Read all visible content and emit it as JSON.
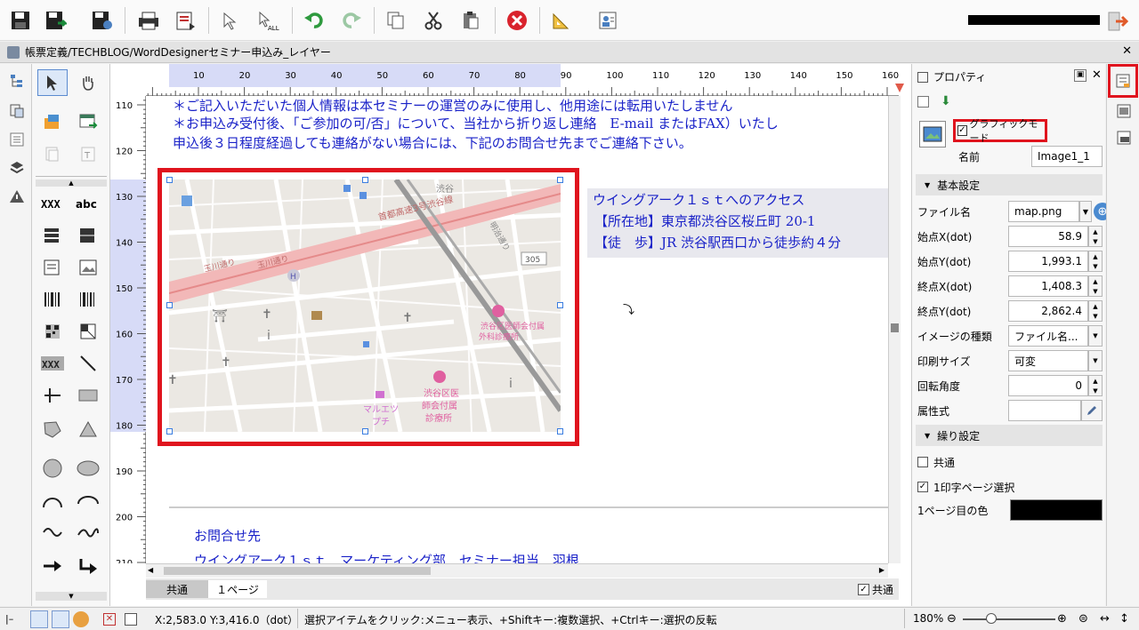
{
  "toolbar": {
    "items": [
      "save-icon",
      "save-as-icon",
      "save-db-icon",
      "print-icon",
      "print-preview-icon",
      "select-tool-icon",
      "select-all-icon",
      "undo-icon",
      "redo-icon",
      "copy-icon",
      "cut-icon",
      "paste-icon",
      "delete-icon",
      "ruler-icon",
      "user-icon"
    ]
  },
  "doc_tab": {
    "title": "帳票定義/TECHBLOG/WordDesignerセミナー申込み_レイヤー"
  },
  "ruler": {
    "h_ticks": [
      "10",
      "20",
      "30",
      "40",
      "50",
      "60",
      "70",
      "80",
      "90",
      "100",
      "110",
      "120",
      "130",
      "140",
      "150",
      "160"
    ],
    "v_ticks": [
      "110",
      "120",
      "130",
      "140",
      "150",
      "160",
      "170",
      "180",
      "190",
      "200",
      "210"
    ]
  },
  "page": {
    "line1": "＊ご記入いただいた個人情報は本セミナーの運営のみに使用し、他用途には転用いたしません",
    "line2": "＊お申込み受付後、「ご参加の可/否」について、当社から折り返し連絡　E-mail またはFAX）いたし",
    "line3": "申込後３日程度経過しても連絡がない場合には、下記のお問合せ先までご連絡下さい。",
    "access_title": "ウイングアーク１ｓｔへのアクセス",
    "access_addr": "【所在地】東京都渋谷区桜丘町 20-1",
    "access_walk": "【徒　歩】JR 渋谷駅西口から徒歩約４分",
    "contact_label": "お問合せ先",
    "contact_detail": "ウイングアーク１ｓｔ　マーケティング部　セミナー担当　羽根"
  },
  "map": {
    "labels": [
      "渋谷",
      "首都高速3号渋谷線",
      "玉川通り",
      "玉川通り",
      "305",
      "明治通り",
      "渋谷区医師会付属",
      "外科診療所",
      "渋谷区医",
      "師会付属",
      "診療所",
      "マルエツ",
      "プチ"
    ]
  },
  "page_tabs": {
    "common": "共通",
    "page1": "１ページ",
    "common_check": "共通"
  },
  "properties": {
    "title": "プロパティ",
    "graphic_mode": "グラフィックモード",
    "name_label": "名前",
    "name_value": "Image1_1",
    "basic_section": "基本設定",
    "file_label": "ファイル名",
    "file_value": "map.png",
    "sx_label": "始点X(dot)",
    "sx_value": "58.9",
    "sy_label": "始点Y(dot)",
    "sy_value": "1,993.1",
    "ex_label": "終点X(dot)",
    "ex_value": "1,408.3",
    "ey_label": "終点Y(dot)",
    "ey_value": "2,862.4",
    "imgtype_label": "イメージの種類",
    "imgtype_value": "ファイル名...",
    "printsize_label": "印刷サイズ",
    "printsize_value": "可変",
    "rotate_label": "回転角度",
    "rotate_value": "0",
    "attr_label": "属性式",
    "attr_value": "",
    "repeat_section": "繰り設定",
    "common_label": "共通",
    "onepage_label": "1印字ページ選択",
    "color_label": "1ページ目の色"
  },
  "status": {
    "coords": "X:2,583.0 Y:3,416.0（dot）",
    "hint": "選択アイテムをクリック:メニュー表示、+Shiftキー:複数選択、+Ctrlキー:選択の反転",
    "zoom": "180%"
  },
  "colors": {
    "accent_red": "#e0141e",
    "text_blue": "#1a22c8",
    "handle_blue": "#3a7de0"
  }
}
